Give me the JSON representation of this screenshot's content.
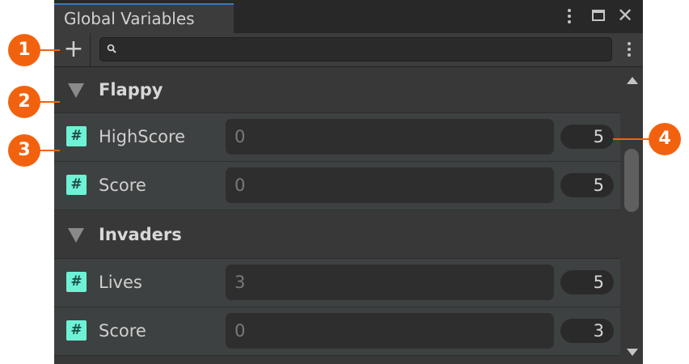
{
  "window": {
    "tab_title": "Global Variables"
  },
  "toolbar": {
    "add_label": "+",
    "search_placeholder": "",
    "search_value": ""
  },
  "groups": [
    {
      "title": "Flappy",
      "variables": [
        {
          "type_icon": "#",
          "name": "HighScore",
          "value": "0",
          "count": "5"
        },
        {
          "type_icon": "#",
          "name": "Score",
          "value": "0",
          "count": "5"
        }
      ]
    },
    {
      "title": "Invaders",
      "variables": [
        {
          "type_icon": "#",
          "name": "Lives",
          "value": "3",
          "count": "5"
        },
        {
          "type_icon": "#",
          "name": "Score",
          "value": "0",
          "count": "3"
        }
      ]
    }
  ],
  "callouts": [
    "1",
    "2",
    "3",
    "4"
  ],
  "colors": {
    "accent_callout": "#f2620e",
    "number_type_icon": "#6ef2d6",
    "tab_highlight": "#3a79bb"
  },
  "icons": [
    "kebab-menu-icon",
    "maximize-icon",
    "close-icon",
    "add-icon",
    "search-icon",
    "collapse-triangle-icon",
    "number-type-icon",
    "scroll-up-icon",
    "scroll-down-icon"
  ]
}
